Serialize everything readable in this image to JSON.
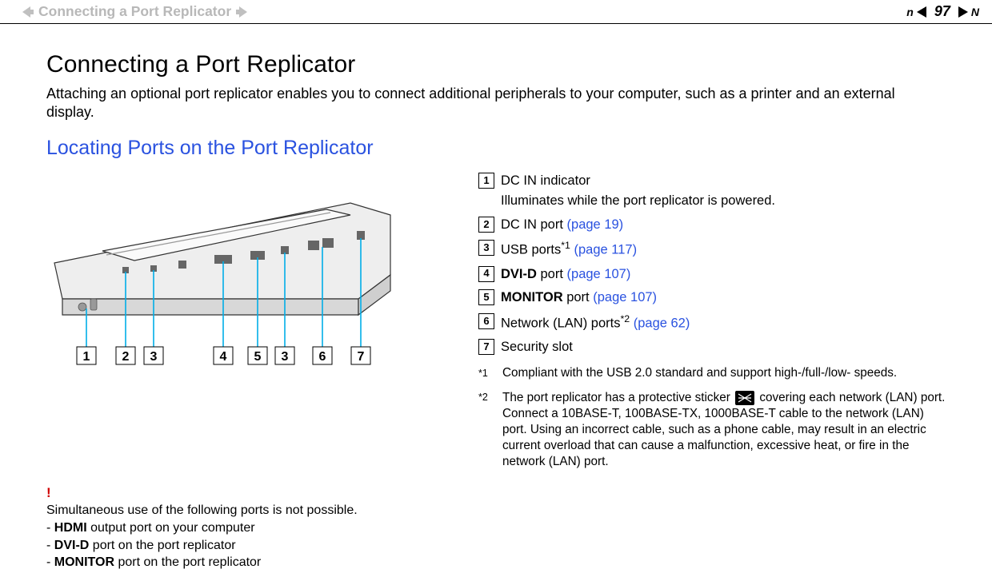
{
  "header": {
    "breadcrumb": "Connecting a Port Replicator",
    "page_number": "97",
    "n_suffix": "n",
    "N_next": "N"
  },
  "page": {
    "title": "Connecting a Port Replicator",
    "intro": "Attaching an optional port replicator enables you to connect additional peripherals to your computer, such as a printer and an external display.",
    "subtitle": "Locating Ports on the Port Replicator"
  },
  "callouts": [
    "1",
    "2",
    "3",
    "4",
    "5",
    "3",
    "6",
    "7"
  ],
  "legend": {
    "i1": {
      "num": "1",
      "text": "DC IN indicator",
      "desc": "Illuminates while the port replicator is powered."
    },
    "i2": {
      "num": "2",
      "text": "DC IN port ",
      "link": "(page 19)"
    },
    "i3": {
      "num": "3",
      "text": "USB ports",
      "sup": "*1",
      "link": " (page 117)"
    },
    "i4": {
      "num": "4",
      "bold": "DVI-D",
      "text": " port ",
      "link": "(page 107)"
    },
    "i5": {
      "num": "5",
      "bold": "MONITOR",
      "text": " port ",
      "link": "(page 107)"
    },
    "i6": {
      "num": "6",
      "text": "Network (LAN) ports",
      "sup": "*2",
      "link": " (page 62)"
    },
    "i7": {
      "num": "7",
      "text": "Security slot"
    }
  },
  "footnotes": {
    "f1": {
      "mark": "*1",
      "text": "Compliant with the USB 2.0 standard and support high-/full-/low- speeds."
    },
    "f2": {
      "mark": "*2",
      "pre": "The port replicator has a protective sticker ",
      "post": " covering each network (LAN) port. Connect a 10BASE-T, 100BASE-TX, 1000BASE-T cable to the network (LAN) port. Using an incorrect cable, such as a phone cable, may result in an electric current overload that can cause a malfunction, excessive heat, or fire in the network (LAN) port."
    }
  },
  "notice": {
    "bang": "!",
    "line0": "Simultaneous use of the following ports is not possible.",
    "l1_pre": "- ",
    "l1_bold": "HDMI",
    "l1_post": " output port on your computer",
    "l2_pre": "- ",
    "l2_bold": "DVI-D",
    "l2_post": " port on the port replicator",
    "l3_pre": "- ",
    "l3_bold": "MONITOR",
    "l3_post": " port on the port replicator"
  }
}
